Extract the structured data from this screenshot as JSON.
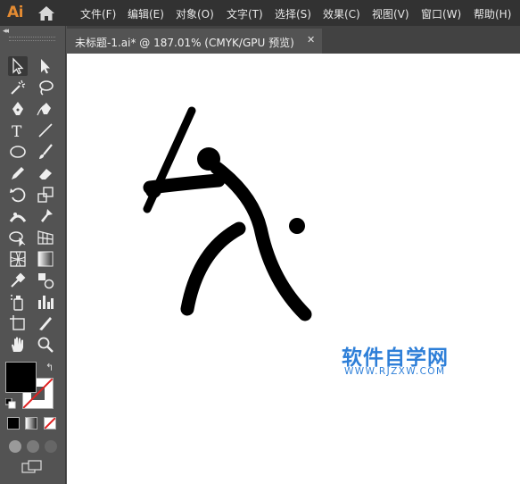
{
  "app": {
    "logo_text": "Ai"
  },
  "menu": [
    "文件(F)",
    "编辑(E)",
    "对象(O)",
    "文字(T)",
    "选择(S)",
    "效果(C)",
    "视图(V)",
    "窗口(W)",
    "帮助(H)"
  ],
  "toolbar": {
    "collapse_label": "◂◂",
    "tools": [
      "selection-tool",
      "direct-selection-tool",
      "magic-wand-tool",
      "lasso-tool",
      "pen-tool",
      "curvature-tool",
      "type-tool",
      "line-segment-tool",
      "ellipse-tool",
      "paintbrush-tool",
      "pencil-tool",
      "eraser-tool",
      "rotate-tool",
      "scale-tool",
      "width-tool",
      "puppet-warp-tool",
      "shape-builder-tool",
      "perspective-grid-tool",
      "mesh-tool",
      "gradient-tool",
      "eyedropper-tool",
      "blend-tool",
      "symbol-sprayer-tool",
      "column-graph-tool",
      "artboard-tool",
      "slice-tool",
      "hand-tool",
      "zoom-tool"
    ],
    "swap_icon": "↰"
  },
  "document_tab": {
    "title": "未标题-1.ai* @ 187.01% (CMYK/GPU 预览)",
    "close_icon": "✕"
  },
  "canvas": {
    "artwork": "baseball-batter-pictogram"
  },
  "watermark": {
    "title": "软件自学网",
    "url": "WWW.RJZXW.COM"
  },
  "colors": {
    "menubar": "#323232",
    "panel": "#535353",
    "logo": "#e38b32",
    "watermark": "#2e7fd8",
    "artwork": "#000000"
  }
}
